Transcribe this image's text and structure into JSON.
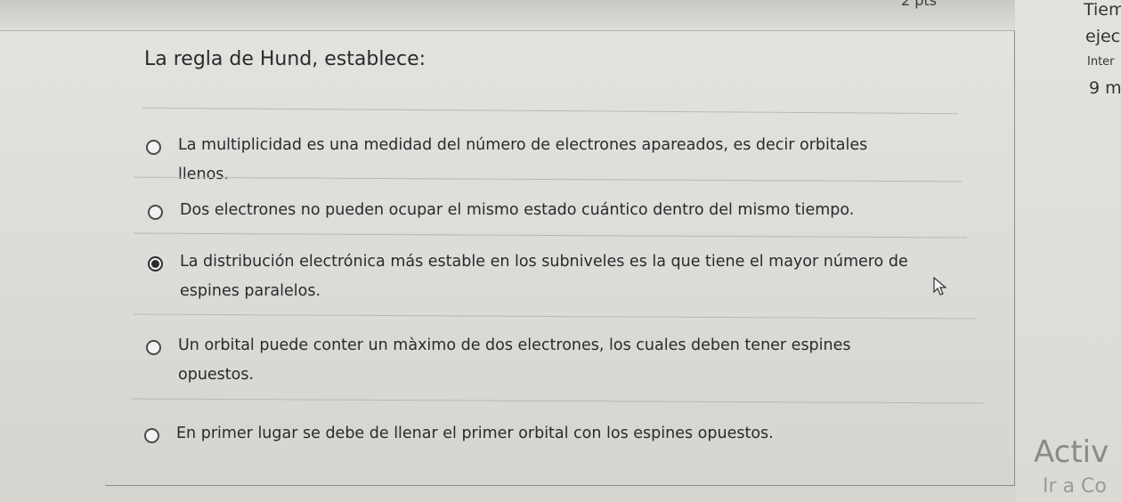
{
  "header": {
    "points_label": "2 pts"
  },
  "question": {
    "title": "La regla de Hund, establece:",
    "selected_index": 2,
    "options": [
      {
        "line1": "La multiplicidad es una medidad del número de electrones apareados, es decir orbitales",
        "line2": "llenos."
      },
      {
        "line1": "Dos electrones no pueden ocupar el mismo estado cuántico dentro del mismo tiempo.",
        "line2": ""
      },
      {
        "line1": "La distribución electrónica más estable en los subniveles es la que tiene el mayor número de",
        "line2": "espines paralelos."
      },
      {
        "line1": "Un orbital puede conter un màximo de dos electrones, los cuales deben tener espines",
        "line2": "opuestos."
      },
      {
        "line1": "En primer lugar se debe de llenar el primer orbital con los espines opuestos.",
        "line2": ""
      }
    ]
  },
  "side_panel": {
    "timer_label": "Tiem",
    "timer_sub": "ejec",
    "internet_label": "Inter",
    "time_remaining": "9 m"
  },
  "watermark": {
    "title": "Activ",
    "subtitle": "Ir a Co"
  },
  "icons": [
    "radio-unselected-icon",
    "radio-selected-icon",
    "mouse-pointer-icon"
  ]
}
